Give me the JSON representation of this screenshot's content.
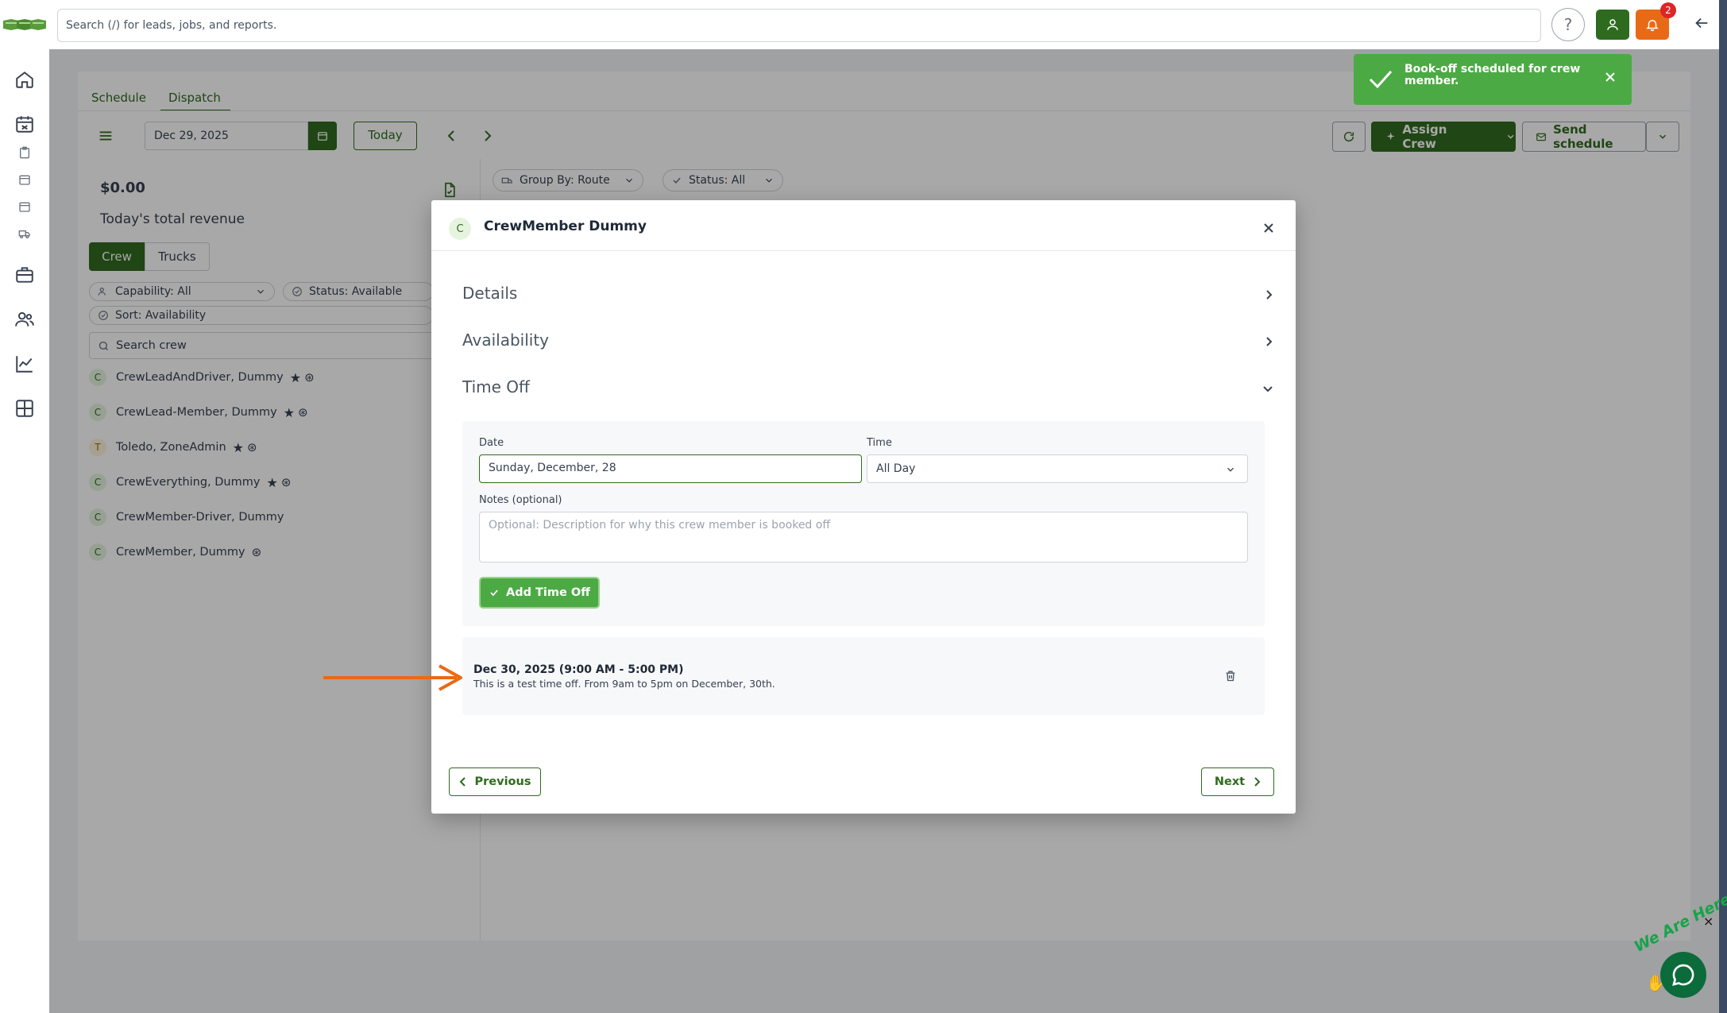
{
  "app": {
    "search_placeholder": "Search (/) for leads, jobs, and reports.",
    "help_label": "?",
    "notification_count": "2"
  },
  "colors": {
    "primary_green": "#2f6b1f",
    "toast_green": "#4caa45",
    "alert_orange": "#e96a16",
    "badge_red": "#dc2626"
  },
  "rail_icons": [
    "home-icon",
    "calendar-icon",
    "clipboard-icon",
    "calendar-small-icon",
    "calendar-small-icon",
    "truck-icon",
    "briefcase-icon",
    "users-icon",
    "chart-icon",
    "grid-icon"
  ],
  "tabs": {
    "schedule": "Schedule",
    "dispatch": "Dispatch"
  },
  "toolbar": {
    "date_value": "Dec 29, 2025",
    "today_label": "Today",
    "assign_crew_label": "Assign Crew",
    "send_schedule_label": "Send schedule"
  },
  "filters": {
    "group_by": "Group By: Route",
    "status": "Status: All"
  },
  "revenue": {
    "amount": "$0.00",
    "label": "Today's total revenue"
  },
  "crew_panel": {
    "tab_crew": "Crew",
    "tab_trucks": "Trucks",
    "capability_filter": "Capability: All",
    "status_filter": "Status: Available",
    "sort_filter": "Sort: Availability",
    "search_placeholder": "Search crew",
    "members": [
      {
        "initial": "C",
        "name": "CrewLeadAndDriver, Dummy"
      },
      {
        "initial": "C",
        "name": "CrewLead-Member, Dummy"
      },
      {
        "initial": "T",
        "name": "Toledo, ZoneAdmin"
      },
      {
        "initial": "C",
        "name": "CrewEverything, Dummy"
      },
      {
        "initial": "C",
        "name": "CrewMember-Driver, Dummy"
      },
      {
        "initial": "C",
        "name": "CrewMember, Dummy"
      }
    ]
  },
  "toast": {
    "message": "Book-off scheduled for crew member."
  },
  "modal": {
    "avatar_initial": "C",
    "title": "CrewMember Dummy",
    "sections": {
      "details": "Details",
      "availability": "Availability",
      "time_off": "Time Off"
    },
    "form": {
      "date_label": "Date",
      "date_value": "Sunday, December, 28",
      "time_label": "Time",
      "time_value": "All Day",
      "notes_label": "Notes (optional)",
      "notes_placeholder": "Optional: Description for why this crew member is booked off",
      "add_label": "Add Time Off"
    },
    "entry": {
      "title": "Dec 30, 2025 (9:00 AM - 5:00 PM)",
      "description": "This is a test time off. From 9am to 5pm on December, 30th."
    },
    "previous_label": "Previous",
    "next_label": "Next"
  },
  "chat_widget": {
    "label": "We Are Here!"
  }
}
